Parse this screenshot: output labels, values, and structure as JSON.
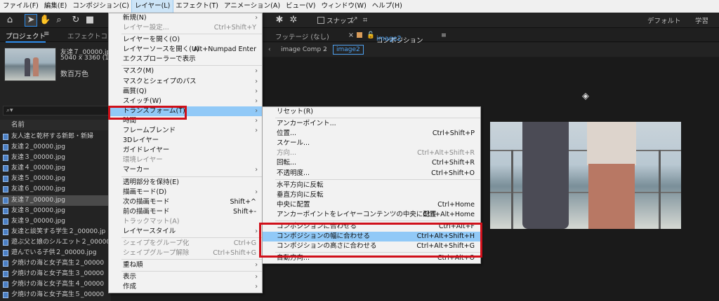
{
  "menubar": {
    "items": [
      "ファイル(F)",
      "編集(E)",
      "コンポジション(C)",
      "レイヤー(L)",
      "エフェクト(T)",
      "アニメーション(A)",
      "ビュー(V)",
      "ウィンドウ(W)",
      "ヘルプ(H)"
    ],
    "active_index": 3
  },
  "toolbar": {
    "icons": [
      "home-icon",
      "selection-arrow-icon",
      "hand-icon",
      "zoom-icon",
      "rotate-icon",
      "camera-icon"
    ],
    "snap_label": "スナップ",
    "workspaces": [
      "デフォルト",
      "学習"
    ]
  },
  "project_panel": {
    "tab_label": "プロジェクト",
    "effects_tab": "エフェクトコ",
    "file_name": "友達７_00000.jpg",
    "file_dims": "5040 x 3360 (1.00)",
    "file_colors": "数百万色",
    "search_icon": "search-icon",
    "column_name": "名前",
    "files": [
      "友人達と乾杯する新郎・新婦",
      "友達２_00000.jpg",
      "友達３_00000.jpg",
      "友達４_00000.jpg",
      "友達５_00000.jpg",
      "友達６_00000.jpg",
      "友達７_00000.jpg",
      "友達８_00000.jpg",
      "友達９_00000.jpg",
      "友達と談笑する学生２_00000.jp",
      "遊ぶ父と娘のシルエット２_00000",
      "遊んでいる子供２_00000.jpg",
      "夕焼けの海と女子高生２_00000",
      "夕焼けの海と女子高生３_00000",
      "夕焼けの海と女子高生４_00000",
      "夕焼けの海と女子高生５_00000"
    ],
    "selected_file_index": 6
  },
  "comp_panel": {
    "footage_tab": "フッテージ (なし)",
    "comp_tab_prefix": "コンポジション",
    "comp_tab_name": "image2",
    "breadcrumb_prev": "image Comp 2",
    "breadcrumb_current": "image2"
  },
  "layer_menu": {
    "items": [
      {
        "label": "新規(N)",
        "arrow": true
      },
      {
        "label": "レイヤー設定...",
        "shortcut": "Ctrl+Shift+Y",
        "disabled": true
      },
      {
        "sep": true
      },
      {
        "label": "レイヤーを開く(O)"
      },
      {
        "label": "レイヤーソースを開く(U)",
        "shortcut": "Alt+Numpad Enter"
      },
      {
        "label": "エクスプローラーで表示"
      },
      {
        "sep": true
      },
      {
        "label": "マスク(M)",
        "arrow": true
      },
      {
        "label": "マスクとシェイプのパス",
        "arrow": true
      },
      {
        "label": "画質(Q)",
        "arrow": true
      },
      {
        "label": "スイッチ(W)",
        "arrow": true
      },
      {
        "label": "トランスフォーム(T)",
        "arrow": true,
        "hover": true
      },
      {
        "label": "時間",
        "arrow": true
      },
      {
        "label": "フレームブレンド",
        "arrow": true
      },
      {
        "label": "3Dレイヤー"
      },
      {
        "label": "ガイドレイヤー"
      },
      {
        "label": "環境レイヤー",
        "disabled": true
      },
      {
        "label": "マーカー",
        "arrow": true
      },
      {
        "sep": true
      },
      {
        "label": "透明部分を保持(E)"
      },
      {
        "label": "描画モード(D)",
        "arrow": true
      },
      {
        "label": "次の描画モード",
        "shortcut": "Shift+^"
      },
      {
        "label": "前の描画モード",
        "shortcut": "Shift+-"
      },
      {
        "label": "トラックマット(A)",
        "disabled": true
      },
      {
        "label": "レイヤースタイル",
        "arrow": true
      },
      {
        "sep": true
      },
      {
        "label": "シェイプをグループ化",
        "shortcut": "Ctrl+G",
        "disabled": true
      },
      {
        "label": "シェイプグループ解除",
        "shortcut": "Ctrl+Shift+G",
        "disabled": true
      },
      {
        "sep": true
      },
      {
        "label": "重ね順",
        "arrow": true
      },
      {
        "sep": true
      },
      {
        "label": "表示",
        "arrow": true
      },
      {
        "label": "作成",
        "arrow": true
      }
    ]
  },
  "transform_menu": {
    "items": [
      {
        "label": "リセット(R)"
      },
      {
        "sep": true
      },
      {
        "label": "アンカーポイント..."
      },
      {
        "label": "位置...",
        "shortcut": "Ctrl+Shift+P"
      },
      {
        "label": "スケール..."
      },
      {
        "label": "方向...",
        "shortcut": "Ctrl+Alt+Shift+R",
        "disabled": true
      },
      {
        "label": "回転...",
        "shortcut": "Ctrl+Shift+R"
      },
      {
        "label": "不透明度...",
        "shortcut": "Ctrl+Shift+O"
      },
      {
        "sep": true
      },
      {
        "label": "水平方向に反転"
      },
      {
        "label": "垂直方向に反転"
      },
      {
        "label": "中央に配置",
        "shortcut": "Ctrl+Home"
      },
      {
        "label": "アンカーポイントをレイヤーコンテンツの中央に配置",
        "shortcut": "Ctrl+Alt+Home"
      },
      {
        "sep": true
      },
      {
        "label": "コンポジションに合わせる",
        "shortcut": "Ctrl+Alt+F"
      },
      {
        "label": "コンポジションの幅に合わせる",
        "shortcut": "Ctrl+Alt+Shift+H",
        "hover": true
      },
      {
        "label": "コンポジションの高さに合わせる",
        "shortcut": "Ctrl+Alt+Shift+G"
      },
      {
        "sep": true
      },
      {
        "label": "自動方向...",
        "shortcut": "Ctrl+Alt+O"
      }
    ]
  },
  "colors": {
    "highlight_red": "#d0101a",
    "menu_hover": "#91c9f7",
    "accent_blue": "#2d8ceb"
  }
}
